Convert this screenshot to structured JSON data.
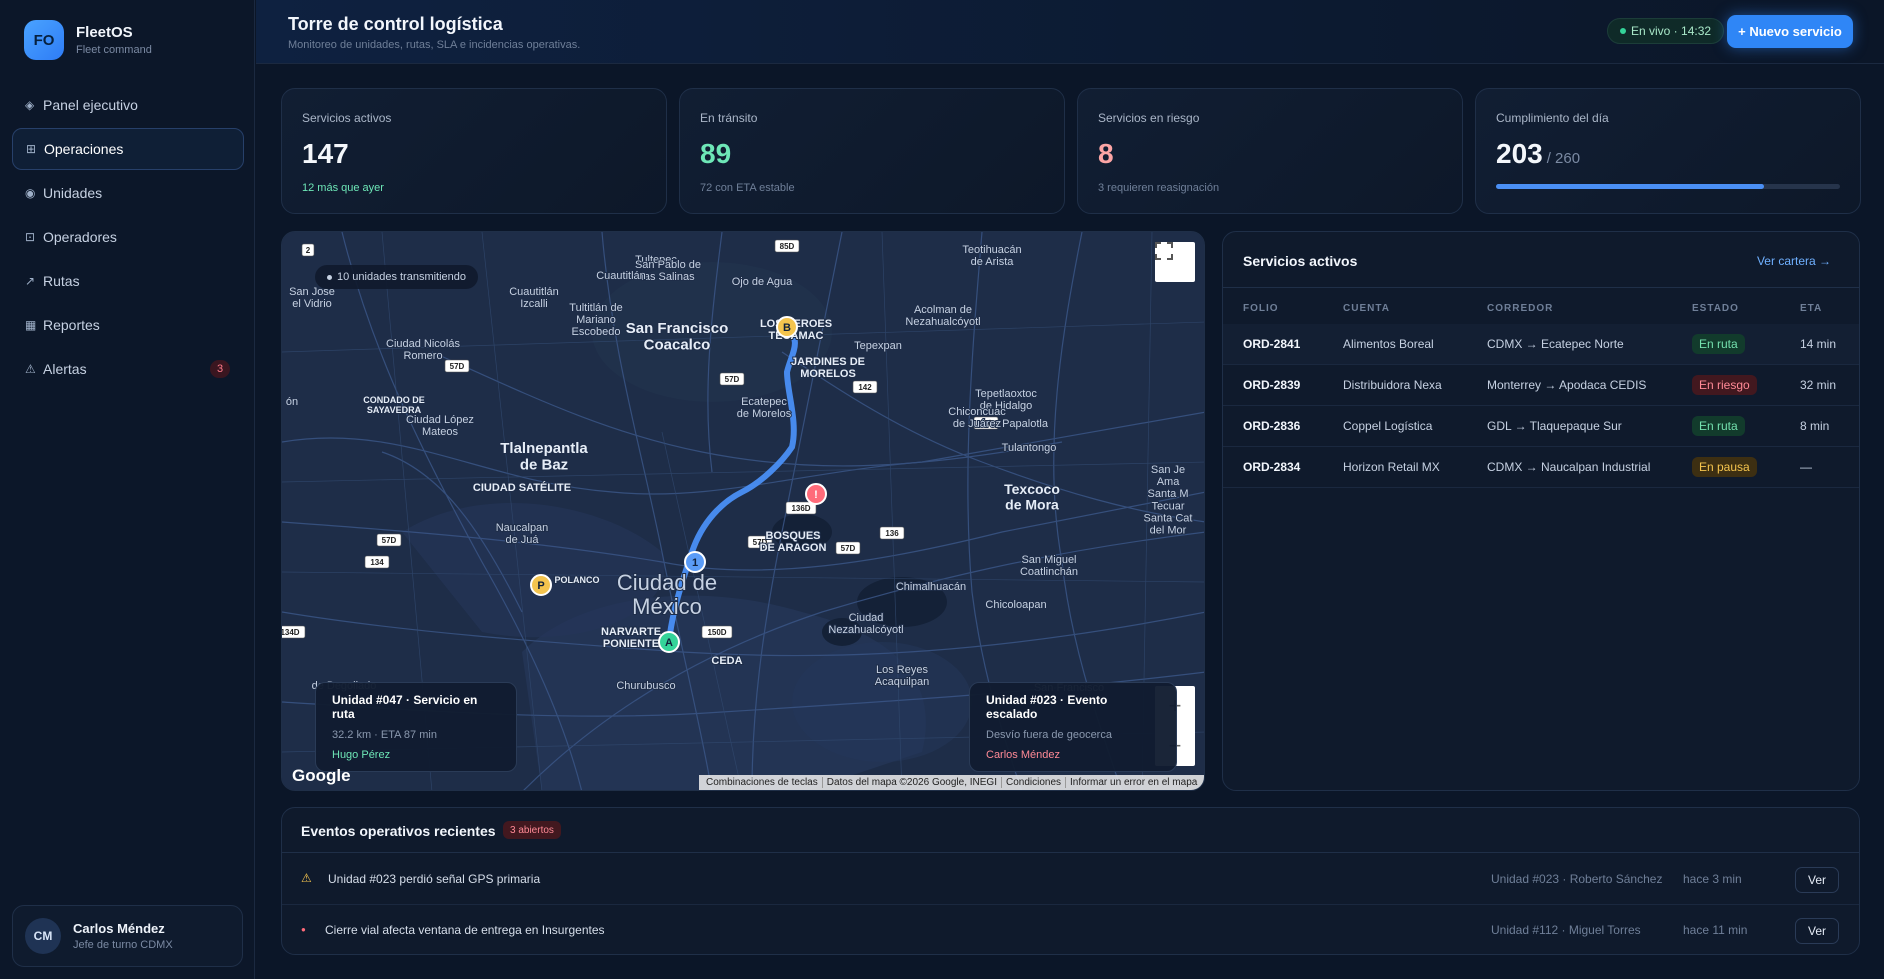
{
  "brand": {
    "initials": "FO",
    "name": "FleetOS",
    "subtitle": "Fleet command"
  },
  "sidebar": {
    "items": [
      {
        "icon": "◈",
        "label": "Panel ejecutivo"
      },
      {
        "icon": "⊞",
        "label": "Operaciones"
      },
      {
        "icon": "◉",
        "label": "Unidades"
      },
      {
        "icon": "⊡",
        "label": "Operadores"
      },
      {
        "icon": "↗",
        "label": "Rutas"
      },
      {
        "icon": "▦",
        "label": "Reportes"
      },
      {
        "icon": "⚠",
        "label": "Alertas",
        "badge": "3"
      }
    ],
    "active_index": 1
  },
  "user": {
    "initials": "CM",
    "name": "Carlos Méndez",
    "role": "Jefe de turno CDMX"
  },
  "header": {
    "title": "Torre de control logística",
    "subtitle": "Monitoreo de unidades, rutas, SLA e incidencias operativas.",
    "live": "En vivo · 14:32",
    "new_button": "+ Nuevo servicio"
  },
  "kpis": [
    {
      "label": "Servicios activos",
      "value": "147",
      "note": "12 más que ayer"
    },
    {
      "label": "En tránsito",
      "value": "89",
      "note": "72 con ETA estable"
    },
    {
      "label": "Servicios en riesgo",
      "value": "8",
      "note": "3 requieren reasignación"
    },
    {
      "label": "Cumplimiento del día",
      "value": "203",
      "total": "/ 260",
      "progress": 0.78
    }
  ],
  "map": {
    "transmitting": "10 unidades transmitiendo",
    "google": "Google",
    "attribution": [
      "Combinaciones de teclas",
      "Datos del mapa ©2026 Google, INEGI",
      "Condiciones",
      "Informar un error en el mapa"
    ],
    "labels": [
      {
        "t": "Teotihuacán de Arista",
        "lines": [
          "Teotihuacán",
          "de Arista"
        ]
      },
      {
        "t": "Tultepec"
      },
      {
        "t": "San Pablo de las Salinas",
        "lines": [
          "San Pablo de",
          "las Salinas"
        ]
      },
      {
        "t": "Ojo de Agua"
      },
      {
        "t": "Cuautitlán"
      },
      {
        "t": "San Jose el Vidrio",
        "lines": [
          "San Jose",
          "el Vidrio"
        ]
      },
      {
        "t": "Cuautitlán Izcalli",
        "lines": [
          "Cuautitlán",
          "Izcalli"
        ]
      },
      {
        "t": "Tultitlán de Mariano Escobedo",
        "lines": [
          "Tultitlán de",
          "Mariano",
          "Escobedo"
        ]
      },
      {
        "t": "San Francisco Coacalco",
        "lines": [
          "San Francisco",
          "Coacalco"
        ]
      },
      {
        "t": "LOS HEROES TECAMAC",
        "lines": [
          "LOS HEROES",
          "TECAMAC"
        ]
      },
      {
        "t": "Acolman de Nezahualcóyotl",
        "lines": [
          "Acolman de",
          "Nezahualcóyotl"
        ]
      },
      {
        "t": "Ciudad Nicolás Romero",
        "lines": [
          "Ciudad Nicolás",
          "Romero"
        ]
      },
      {
        "t": "JARDINES DE MORELOS",
        "lines": [
          "JARDINES DE",
          "MORELOS"
        ]
      },
      {
        "t": "Tepexpan"
      },
      {
        "t": "CONDADO DE SAYAVEDRA",
        "lines": [
          "CONDADO DE",
          "SAYAVEDRA"
        ]
      },
      {
        "t": "Ecatepec de Morelos",
        "lines": [
          "Ecatepec",
          "de Morelos"
        ]
      },
      {
        "t": "Tepetlaoxtoc de Hidalgo",
        "lines": [
          "Tepetlaoxtoc",
          "de Hidalgo"
        ]
      },
      {
        "t": "Ciudad López Mateos",
        "lines": [
          "Ciudad López",
          "Mateos"
        ]
      },
      {
        "t": "Chiconcuac de Juárez",
        "lines": [
          "Chiconcuac",
          "de Juárez"
        ]
      },
      {
        "t": "Papalotla"
      },
      {
        "t": "Tlalnepantla de Baz",
        "lines": [
          "Tlalnepantla",
          "de Baz"
        ]
      },
      {
        "t": "Tulantongo"
      },
      {
        "t": "CIUDAD SATÉLITE"
      },
      {
        "t": "Texcoco de Mora",
        "lines": [
          "Texcoco",
          "de Mora"
        ]
      },
      {
        "t": "Naucalpan de Juárez",
        "lines": [
          "Naucalpan",
          "de Juá"
        ]
      },
      {
        "t": "BOSQUES DE ARAGON",
        "lines": [
          "BOSQUES",
          "DE ARAGON"
        ]
      },
      {
        "t": "San Miguel Coatlinchán",
        "lines": [
          "San Miguel",
          "Coatlinchán"
        ]
      },
      {
        "t": "POLANCO"
      },
      {
        "t": "Ciudad de México",
        "lines": [
          "Ciudad de",
          "México"
        ]
      },
      {
        "t": "Chimalhuacán"
      },
      {
        "t": "Chicoloapan"
      },
      {
        "t": "NARVARTE PONIENTE",
        "lines": [
          "NARVARTE",
          "PONIENTE"
        ]
      },
      {
        "t": "Ciudad Nezahualcóyotl",
        "lines": [
          "Ciudad",
          "Nezahualcóyotl"
        ]
      },
      {
        "t": "CEDA"
      },
      {
        "t": "Los Reyes Acaquilpan",
        "lines": [
          "Los Reyes",
          "Acaquilpan"
        ]
      },
      {
        "t": "Churubusco"
      },
      {
        "t": "San Francisco"
      },
      {
        "t": "de Degollado"
      },
      {
        "t": "ón"
      },
      {
        "t": "San Je Ama Santa M Tecuar Santa Cat del Mor",
        "lines": [
          "San Je",
          "Ama",
          "Santa M",
          "Tecuar",
          "Santa Cat",
          "del Mor"
        ]
      }
    ],
    "highways": [
      "2",
      "85D",
      "57D",
      "57D",
      "142",
      "136",
      "136D",
      "57D",
      "57D",
      "136",
      "57D",
      "134",
      "134D",
      "150D"
    ],
    "markers": [
      "A",
      "B",
      "1",
      "P",
      "!"
    ],
    "cards": [
      {
        "title": "Unidad #047 · Servicio en ruta",
        "meta": "32.2 km · ETA 87 min",
        "operator": "Hugo Pérez",
        "color": "#6ee7b7"
      },
      {
        "title": "Unidad #023 · Evento escalado",
        "meta": "Desvío fuera de geocerca",
        "operator": "Carlos Méndez",
        "color": "#ff8a96"
      }
    ]
  },
  "services": {
    "title": "Servicios activos",
    "link": "Ver cartera →",
    "columns": [
      "FOLIO",
      "CUENTA",
      "CORREDOR",
      "ESTADO",
      "ETA"
    ],
    "rows": [
      {
        "folio": "ORD-2841",
        "cuenta": "Alimentos Boreal",
        "corredor": "CDMX → Ecatepec Norte",
        "estado": "En ruta",
        "eta": "14 min",
        "tone": "green"
      },
      {
        "folio": "ORD-2839",
        "cuenta": "Distribuidora Nexa",
        "corredor": "Monterrey → Apodaca CEDIS",
        "estado": "En riesgo",
        "eta": "32 min",
        "tone": "red"
      },
      {
        "folio": "ORD-2836",
        "cuenta": "Coppel Logística",
        "corredor": "GDL → Tlaquepaque Sur",
        "estado": "En ruta",
        "eta": "8 min",
        "tone": "green"
      },
      {
        "folio": "ORD-2834",
        "cuenta": "Horizon Retail MX",
        "corredor": "CDMX → Naucalpan Industrial",
        "estado": "En pausa",
        "eta": "—",
        "tone": "amber"
      }
    ]
  },
  "events": {
    "title": "Eventos operativos recientes",
    "badge": "3 abiertos",
    "rows": [
      {
        "icon": "⚠",
        "icon_color": "#f4c44e",
        "text": "Unidad #023 perdió señal GPS primaria",
        "unit": "Unidad #023 · Roberto Sánchez",
        "time": "hace 3 min",
        "action": "Ver"
      },
      {
        "icon": "●",
        "icon_color": "#ff6b7a",
        "text": "Cierre vial afecta ventana de entrega en Insurgentes",
        "unit": "Unidad #112 · Miguel Torres",
        "time": "hace 11 min",
        "action": "Ver"
      }
    ]
  },
  "colors": {
    "accent": "#2f86f6",
    "route": "#4a8ff5",
    "map_bg": "#1d2c46",
    "ok": "#6ee7b7",
    "risk": "#ff8a96",
    "warn": "#f4c44e"
  }
}
